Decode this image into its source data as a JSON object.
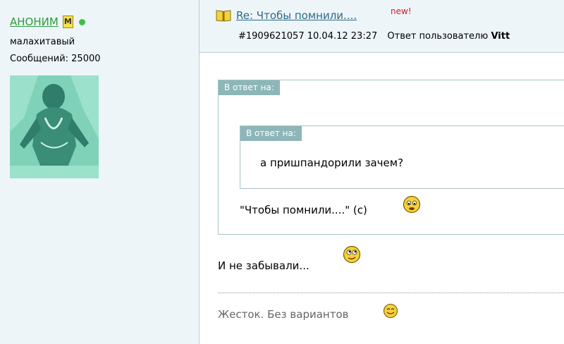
{
  "author": {
    "username": "АНОНИМ",
    "moderator_badge": "М",
    "rank": "малахитавый",
    "posts": "Сообщений: 25000",
    "online_color": "#3fbf3f"
  },
  "post": {
    "title": "Re: Чтобы помнили....",
    "new_label": "new!",
    "id": "#1909621057",
    "datetime": "10.04.12 23:27",
    "reply_label": "Ответ пользователю",
    "reply_to": "Vitt"
  },
  "quote_outer": {
    "label": "В ответ на:",
    "text": "\"Чтобы помнили....\" (с)"
  },
  "quote_inner": {
    "label": "В ответ на:",
    "text": "а пришпандорили зачем?"
  },
  "body": {
    "text": "И не забывали..."
  },
  "signature": {
    "text": "Жесток. Без вариантов"
  },
  "icons": {
    "title": "book-icon",
    "outer_quote": "worried-smiley-icon",
    "body": "rolling-eyes-smiley-icon",
    "signature": "smiling-smiley-icon"
  },
  "colors": {
    "username": "#2c9a3a",
    "link": "#2a6a8a",
    "new": "#d21d1d",
    "quote_header": "#8db6b8"
  }
}
